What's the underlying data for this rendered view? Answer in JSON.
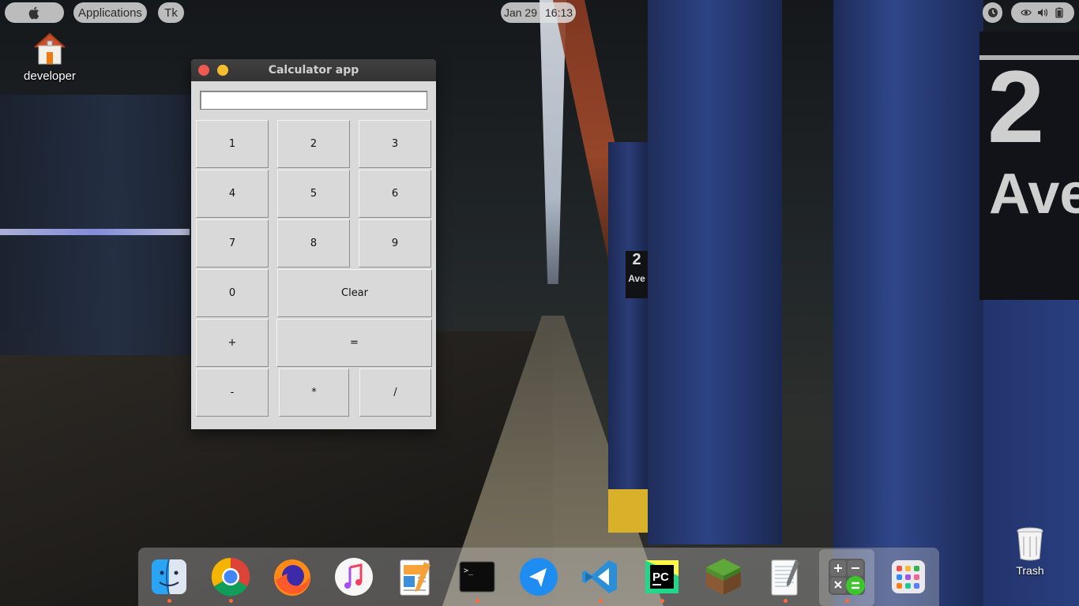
{
  "topbar": {
    "applications_label": "Applications",
    "active_app_label": "Tk",
    "date": "Jan 29",
    "time": "16:13"
  },
  "desktop": {
    "home_label": "developer",
    "trash_label": "Trash"
  },
  "window": {
    "title": "Calculator app",
    "display_value": "",
    "keys": {
      "k1": "1",
      "k2": "2",
      "k3": "3",
      "k4": "4",
      "k5": "5",
      "k6": "6",
      "k7": "7",
      "k8": "8",
      "k9": "9",
      "k0": "0",
      "clear": "Clear",
      "plus": "+",
      "equals": "=",
      "minus": "-",
      "multiply": "*",
      "divide": "/"
    }
  },
  "dock": {
    "items": [
      "finder-icon",
      "chrome-icon",
      "firefox-icon",
      "music-icon",
      "pages-icon",
      "terminal-icon",
      "send-icon",
      "vscode-icon",
      "pycharm-icon",
      "minecraft-icon",
      "textedit-icon",
      "calculator-icon",
      "launchpad-icon"
    ]
  },
  "colors": {
    "close": "#ee5a52",
    "minimize": "#f4bc2f",
    "dock_indicator": "#ff6a3a"
  }
}
